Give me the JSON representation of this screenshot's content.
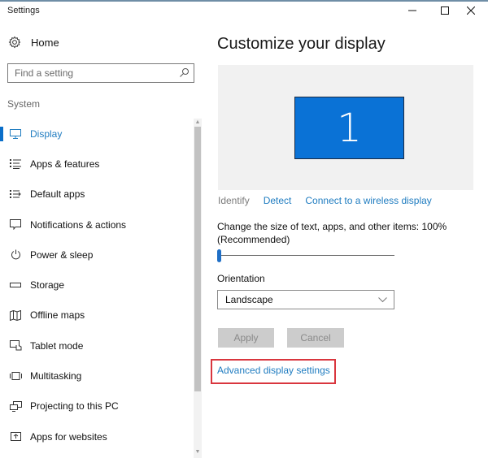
{
  "window": {
    "title": "Settings",
    "controls": {
      "minimize": "—",
      "maximize": "☐",
      "close": "✕"
    }
  },
  "sidebar": {
    "home_label": "Home",
    "search": {
      "placeholder": "Find a setting",
      "value": ""
    },
    "section_label": "System",
    "items": [
      {
        "label": "Display",
        "icon": "monitor-icon",
        "active": true
      },
      {
        "label": "Apps & features",
        "icon": "list-icon",
        "active": false
      },
      {
        "label": "Default apps",
        "icon": "default-apps-icon",
        "active": false
      },
      {
        "label": "Notifications & actions",
        "icon": "notification-icon",
        "active": false
      },
      {
        "label": "Power & sleep",
        "icon": "power-icon",
        "active": false
      },
      {
        "label": "Storage",
        "icon": "storage-icon",
        "active": false
      },
      {
        "label": "Offline maps",
        "icon": "map-icon",
        "active": false
      },
      {
        "label": "Tablet mode",
        "icon": "tablet-mode-icon",
        "active": false
      },
      {
        "label": "Multitasking",
        "icon": "multitasking-icon",
        "active": false
      },
      {
        "label": "Projecting to this PC",
        "icon": "projecting-icon",
        "active": false
      },
      {
        "label": "Apps for websites",
        "icon": "apps-websites-icon",
        "active": false
      }
    ]
  },
  "main": {
    "title": "Customize your display",
    "monitor_number": "1",
    "links": {
      "identify": "Identify",
      "detect": "Detect",
      "connect": "Connect to a wireless display"
    },
    "scale": {
      "label_line1": "Change the size of text, apps, and other items: 100%",
      "label_line2": "(Recommended)",
      "slider_fraction": 0.0
    },
    "orientation": {
      "label": "Orientation",
      "value": "Landscape"
    },
    "buttons": {
      "apply": "Apply",
      "cancel": "Cancel"
    },
    "advanced_link": "Advanced display settings"
  },
  "colors": {
    "accent": "#0a6ec9",
    "link": "#1f7cc0",
    "monitor_fill": "#0a72d6",
    "highlight_box": "#d9363e"
  }
}
